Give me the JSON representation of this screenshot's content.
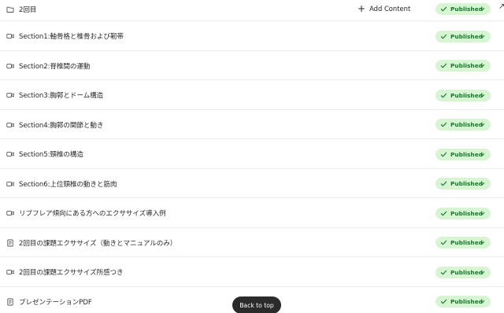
{
  "folder": {
    "title": "2回目",
    "icon": "folder-icon",
    "add_content_label": "Add Content",
    "status_label": "Published"
  },
  "items": [
    {
      "title": "Section1:軸骨格と椎骨および靭帯",
      "icon": "video-icon",
      "status": "Published"
    },
    {
      "title": "Section2:脊椎間の運動",
      "icon": "video-icon",
      "status": "Published"
    },
    {
      "title": "Section3:胸郭とドーム構造",
      "icon": "video-icon",
      "status": "Published"
    },
    {
      "title": "Section4:胸郭の関節と動き",
      "icon": "video-icon",
      "status": "Published"
    },
    {
      "title": "Section5:頸椎の構造",
      "icon": "video-icon",
      "status": "Published"
    },
    {
      "title": "Section6:上位頸椎の動きと筋肉",
      "icon": "video-icon",
      "status": "Published"
    },
    {
      "title": "リブフレア傾向にある方へのエクササイズ導入例",
      "icon": "video-icon",
      "status": "Published"
    },
    {
      "title": "2回目の課題エクササイズ（動きとマニュアルのみ）",
      "icon": "document-icon",
      "status": "Published"
    },
    {
      "title": "2回目の課題エクササイズ所感つき",
      "icon": "video-icon",
      "status": "Published"
    },
    {
      "title": "プレゼンテーションPDF",
      "icon": "document-icon",
      "status": "Published"
    }
  ],
  "back_to_top_label": "Back to top",
  "colors": {
    "badge_bg": "#d7f5d2",
    "badge_text": "#157a2e",
    "back_to_top_bg": "#2b2b2b"
  }
}
